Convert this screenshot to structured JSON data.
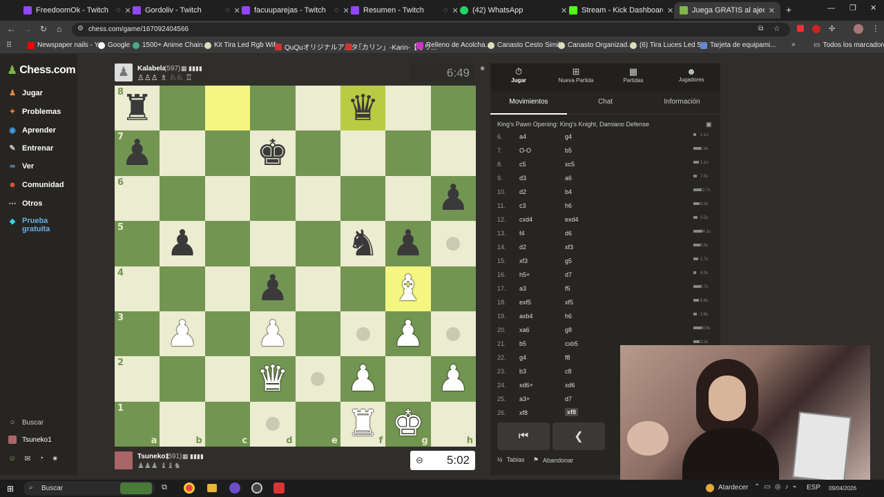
{
  "tabs": [
    {
      "title": "FreedoomOk - Twitch",
      "color": "#9146ff"
    },
    {
      "title": "Gordoliv - Twitch",
      "color": "#9146ff"
    },
    {
      "title": "facuuparejas - Twitch",
      "color": "#9146ff"
    },
    {
      "title": "Resumen - Twitch",
      "color": "#9146ff"
    },
    {
      "title": "(42) WhatsApp",
      "color": "#25d366"
    },
    {
      "title": "Stream - Kick Dashboard",
      "color": "#53fc18"
    },
    {
      "title": "Juega GRATIS al ajedrez online",
      "color": "#81b64c"
    }
  ],
  "url": "chess.com/game/167092404566",
  "bookmarks": [
    "Newspaper nails - Y...",
    "Google",
    "1500+ Anime Chain...",
    "Kit Tira Led Rgb Wif...",
    "QuQuオリジナルアパタ...",
    "「カリン」-Karin-【オリ...",
    "Relleno de Acolcha...",
    "Canasto Cesto Simil...",
    "Canasto Organizad...",
    "(6) Tira Luces Led 5...",
    "Tarjeta de equipami...",
    "Todos los marcadores"
  ],
  "sidebar": {
    "logo": "Chess.com",
    "items": [
      {
        "label": "Jugar",
        "icon": "pawn-icon"
      },
      {
        "label": "Problemas",
        "icon": "puzzle-icon"
      },
      {
        "label": "Aprender",
        "icon": "learn-icon"
      },
      {
        "label": "Entrenar",
        "icon": "train-icon"
      },
      {
        "label": "Ver",
        "icon": "binoculars-icon"
      },
      {
        "label": "Comunidad",
        "icon": "community-icon"
      },
      {
        "label": "Otros",
        "icon": "more-icon"
      },
      {
        "label": "Prueba gratuita",
        "icon": "diamond-icon"
      }
    ],
    "search": "Buscar",
    "user": "Tsuneko1"
  },
  "top_player": {
    "name": "Kalabela",
    "rating": "(597)",
    "clock": "6:49"
  },
  "bottom_player": {
    "name": "Tsuneko1",
    "rating": "(591)",
    "clock": "5:02"
  },
  "board": {
    "ranks": [
      "8",
      "7",
      "6",
      "5",
      "4",
      "3",
      "2",
      "1"
    ],
    "files": [
      "a",
      "b",
      "c",
      "d",
      "e",
      "f",
      "g",
      "h"
    ],
    "rows": [
      [
        "bR",
        "",
        "",
        "",
        "",
        "bQ",
        "",
        ""
      ],
      [
        "bP",
        "",
        "",
        "bK",
        "",
        "",
        "",
        ""
      ],
      [
        "",
        "",
        "",
        "",
        "",
        "",
        "",
        "bP"
      ],
      [
        "",
        "bP",
        "",
        "",
        "",
        "bN",
        "bP",
        ""
      ],
      [
        "",
        "",
        "",
        "bP",
        "",
        "",
        "wB",
        ""
      ],
      [
        "",
        "wP",
        "",
        "wP",
        "",
        "",
        "wP",
        ""
      ],
      [
        "",
        "",
        "",
        "wQ",
        "",
        "wP",
        "",
        "wP"
      ],
      [
        "",
        "",
        "",
        "",
        "",
        "wR",
        "wK",
        ""
      ]
    ],
    "highlights": [
      "c8",
      "f8",
      "g4"
    ],
    "dots": [
      "h5",
      "f3",
      "h3",
      "e2",
      "d1"
    ]
  },
  "panel": {
    "actions": [
      "Jugar",
      "Nueva Partida",
      "Partidas",
      "Jugadores"
    ],
    "tabs": [
      "Movimientos",
      "Chat",
      "Información"
    ],
    "opening": "King's Pawn Opening: King's Knight, Damiano Defense",
    "moves": [
      {
        "n": "6.",
        "w": "a4",
        "b": "g4"
      },
      {
        "n": "7.",
        "w": "O-O",
        "b": "b5"
      },
      {
        "n": "8.",
        "w": "c5",
        "b": "xc5"
      },
      {
        "n": "9.",
        "w": "d3",
        "b": "a6"
      },
      {
        "n": "10.",
        "w": "d2",
        "b": "b4"
      },
      {
        "n": "11.",
        "w": "c3",
        "b": "h6"
      },
      {
        "n": "12.",
        "w": "cxd4",
        "b": "exd4"
      },
      {
        "n": "13.",
        "w": "f4",
        "b": "d6"
      },
      {
        "n": "14.",
        "w": "d2",
        "b": "xf3"
      },
      {
        "n": "15.",
        "w": "xf3",
        "b": "g5"
      },
      {
        "n": "16.",
        "w": "h5+",
        "b": "d7"
      },
      {
        "n": "17.",
        "w": "a3",
        "b": "f5"
      },
      {
        "n": "18.",
        "w": "exf5",
        "b": "xf5"
      },
      {
        "n": "19.",
        "w": "axb4",
        "b": "h6"
      },
      {
        "n": "20.",
        "w": "xa6",
        "b": "g8"
      },
      {
        "n": "21.",
        "w": "b5",
        "b": "cxb5"
      },
      {
        "n": "22.",
        "w": "g4",
        "b": "f8"
      },
      {
        "n": "23.",
        "w": "b3",
        "b": "c8"
      },
      {
        "n": "24.",
        "w": "xd6+",
        "b": "xd6"
      },
      {
        "n": "25.",
        "w": "a3+",
        "b": "d7"
      },
      {
        "n": "26.",
        "w": "xf8",
        "b": "xf8"
      }
    ],
    "times": [
      "1.1s",
      "2.4s",
      "1.1s",
      "7.0s",
      "12.7s",
      "8.2s",
      "5.5s",
      "34.1s",
      "9.5s",
      "1.7s",
      "4.3s",
      "9.7s",
      "6.6s",
      "3.8s",
      "49.9s",
      "3.2s"
    ],
    "footer": {
      "draw": "Tablas",
      "resign": "Abandonar"
    }
  },
  "taskbar": {
    "search": "Buscar",
    "weather": "Atardecer",
    "lang": "ESP",
    "date": "09/04/2026"
  }
}
